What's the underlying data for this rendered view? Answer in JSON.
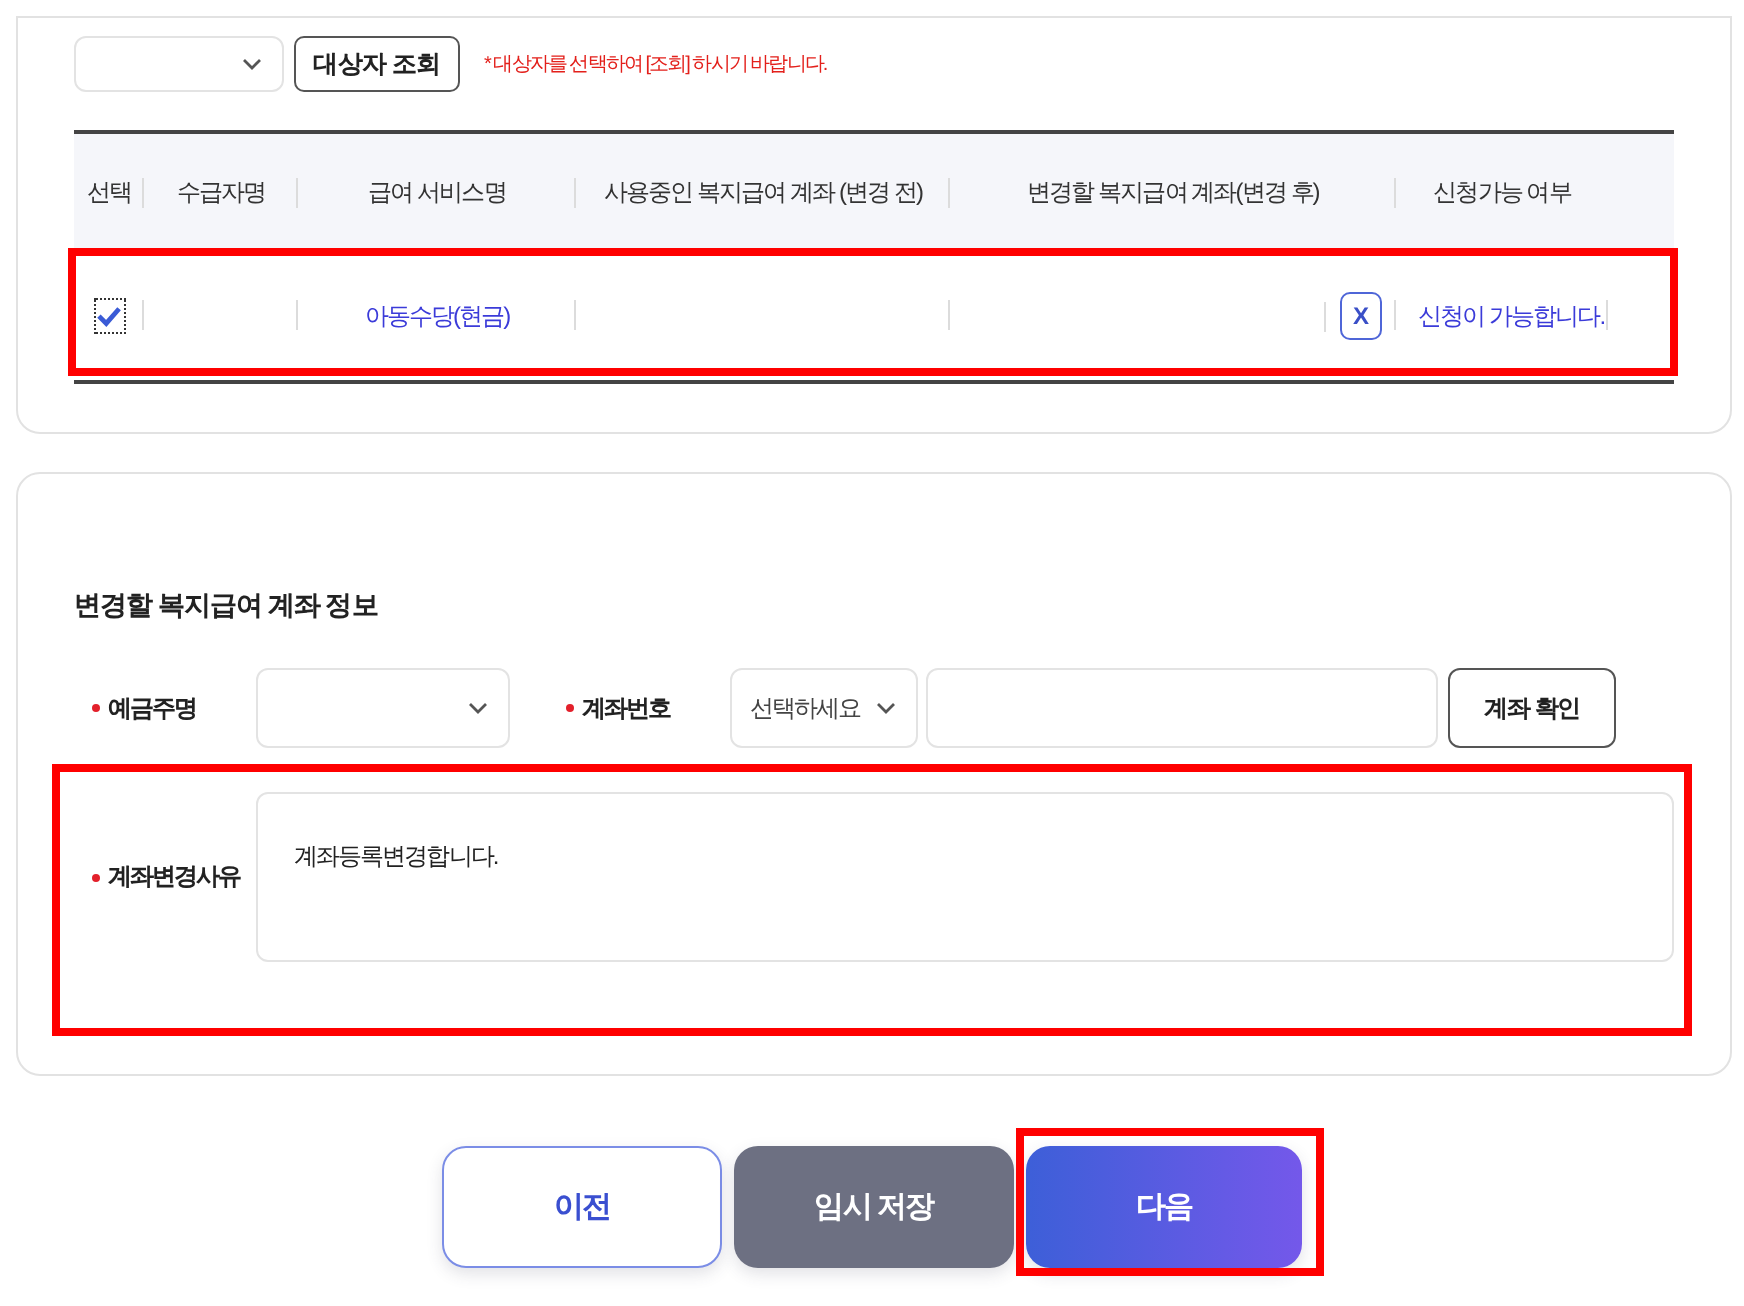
{
  "lookup": {
    "button": "대상자 조회",
    "notice": "* 대상자를 선택하여 [조회] 하시기 바랍니다."
  },
  "table": {
    "columns": [
      "선택",
      "수급자명",
      "급여 서비스명",
      "사용중인 복지급여 계좌 (변경 전)",
      "변경할 복지급여 계좌(변경 후)",
      "신청가능 여부"
    ],
    "rows": [
      {
        "selected": true,
        "service": "아동수당(현금)",
        "clear_button": "X",
        "status": "신청이 가능합니다.",
        "highlighted": true
      }
    ]
  },
  "account_form": {
    "title": "변경할 복지급여 계좌 정보",
    "holder": {
      "label": "예금주명",
      "required": true
    },
    "account_number": {
      "label": "계좌번호",
      "required": true,
      "bank_select": {
        "placeholder": "선택하세요"
      },
      "confirm_button": "계좌 확인"
    },
    "reason": {
      "label": "계좌변경사유",
      "required": true,
      "value": "계좌등록변경합니다.",
      "highlighted": true
    }
  },
  "footer_buttons": [
    {
      "kind": "outline",
      "label": "이전",
      "highlighted": false
    },
    {
      "kind": "muted",
      "label": "임시 저장",
      "highlighted": false
    },
    {
      "kind": "primary",
      "label": "다음",
      "highlighted": true
    }
  ]
}
